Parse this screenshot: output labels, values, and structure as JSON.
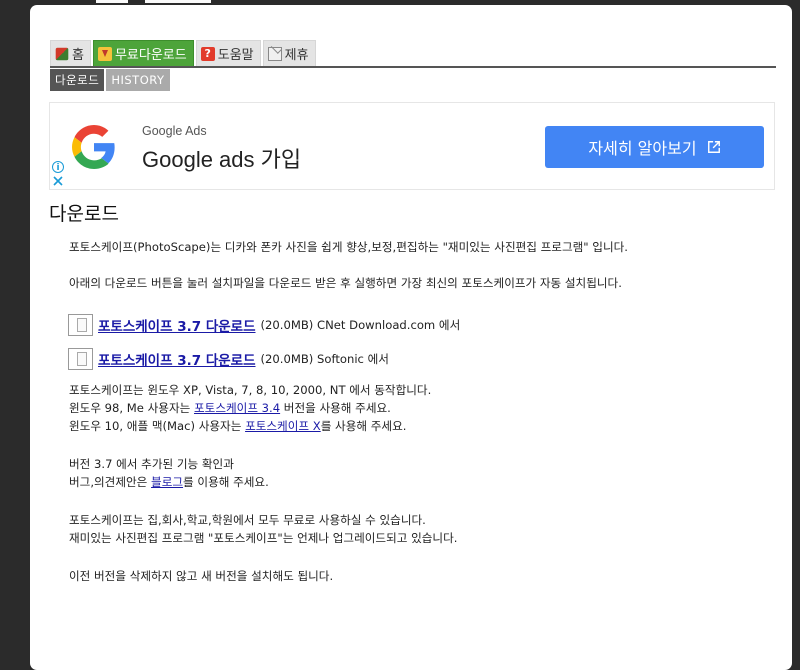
{
  "tabs": [
    {
      "label": "홈",
      "icon": "home-icon",
      "active": false
    },
    {
      "label": "무료다운로드",
      "icon": "download-icon",
      "active": true
    },
    {
      "label": "도움말",
      "icon": "help-icon",
      "active": false
    },
    {
      "label": "제휴",
      "icon": "mail-icon",
      "active": false
    }
  ],
  "subtabs": [
    {
      "label": "다운로드",
      "active": true
    },
    {
      "label": "HISTORY",
      "active": false
    }
  ],
  "ad": {
    "small_text": "Google Ads",
    "big_text": "Google ads 가입",
    "button_label": "자세히 알아보기",
    "info_icon": "info-icon",
    "close_icon": "close-icon",
    "button_color": "#4285f4"
  },
  "page": {
    "title": "다운로드",
    "intro": "포토스케이프(PhotoScape)는 디카와 폰카 사진을 쉽게 향상,보정,편집하는 \"재미있는 사진편집 프로그램\" 입니다.",
    "instruction": "아래의 다운로드 버튼을 눌러 설치파일을 다운로드 받은 후 실행하면 가장 최신의 포토스케이프가 자동 설치됩니다.",
    "downloads": [
      {
        "link": "포토스케이프 3.7 다운로드",
        "meta": "(20.0MB) CNet Download.com 에서"
      },
      {
        "link": "포토스케이프 3.7 다운로드",
        "meta": "(20.0MB) Softonic 에서"
      }
    ],
    "os_line1": "포토스케이프는 윈도우 XP, Vista, 7, 8, 10, 2000, NT 에서 동작합니다.",
    "os_line2_pre": "윈도우 98, Me 사용자는 ",
    "os_line2_link": "포토스케이프 3.4",
    "os_line2_post": " 버전을 사용해 주세요.",
    "os_line3_pre": "윈도우 10, 애플 맥(Mac) 사용자는 ",
    "os_line3_link": "포토스케이프 X",
    "os_line3_post": "를 사용해 주세요.",
    "feature_line": "버전 3.7 에서 추가된 기능 확인과",
    "blog_pre": "버그,의견제안은 ",
    "blog_link": "블로그",
    "blog_post": "를 이용해 주세요.",
    "free_line1": "포토스케이프는 집,회사,학교,학원에서 모두 무료로 사용하실 수 있습니다.",
    "free_line2": "재미있는 사진편집 프로그램 \"포토스케이프\"는 언제나 업그레이드되고 있습니다.",
    "install_note": "이전 버전을 삭제하지 않고 새 버전을 설치해도 됩니다."
  },
  "colors": {
    "active_tab": "#4da43a",
    "active_subtab": "#555555",
    "inactive_subtab": "#aaaaaa",
    "link": "#1a1aa6"
  }
}
